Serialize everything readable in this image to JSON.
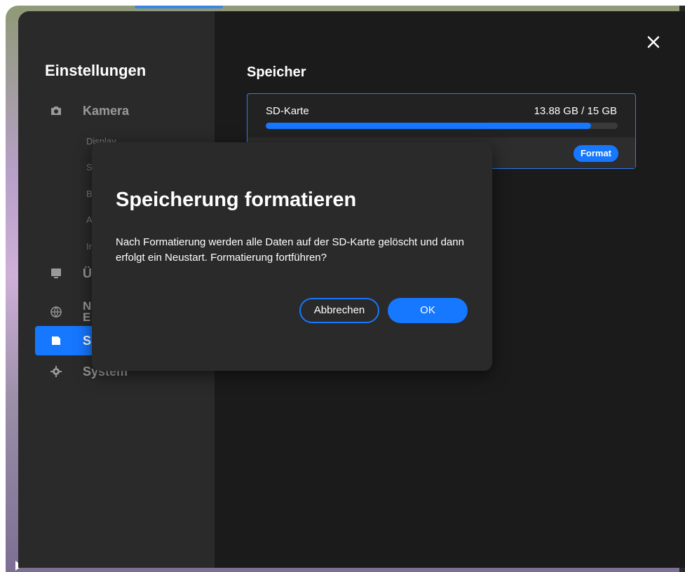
{
  "sidebar": {
    "title": "Einstellungen",
    "items": [
      {
        "label": "Kamera",
        "icon": "camera-icon"
      },
      {
        "label": "Ü",
        "icon": "monitor-icon"
      },
      {
        "label": "N\nE",
        "icon": "globe-icon"
      },
      {
        "label": "S",
        "icon": "sd-card-icon"
      },
      {
        "label": "System",
        "icon": "gear-icon"
      }
    ],
    "subitems": [
      "Display",
      "S",
      "B",
      "A",
      "Ir"
    ]
  },
  "main": {
    "title": "Speicher",
    "storage": {
      "label": "SD-Karte",
      "size": "13.88 GB / 15 GB",
      "used_fraction": 0.925,
      "format_label": "Format"
    }
  },
  "dialog": {
    "title": "Speicherung formatieren",
    "message": "Nach Formatierung werden alle Daten auf der SD-Karte gelöscht und dann erfolgt ein Neustart. Formatierung fortführen?",
    "cancel_label": "Abbrechen",
    "ok_label": "OK"
  },
  "colors": {
    "accent": "#1677ff",
    "panel": "#1b1b1b",
    "sidebar": "#2a2a2a"
  }
}
